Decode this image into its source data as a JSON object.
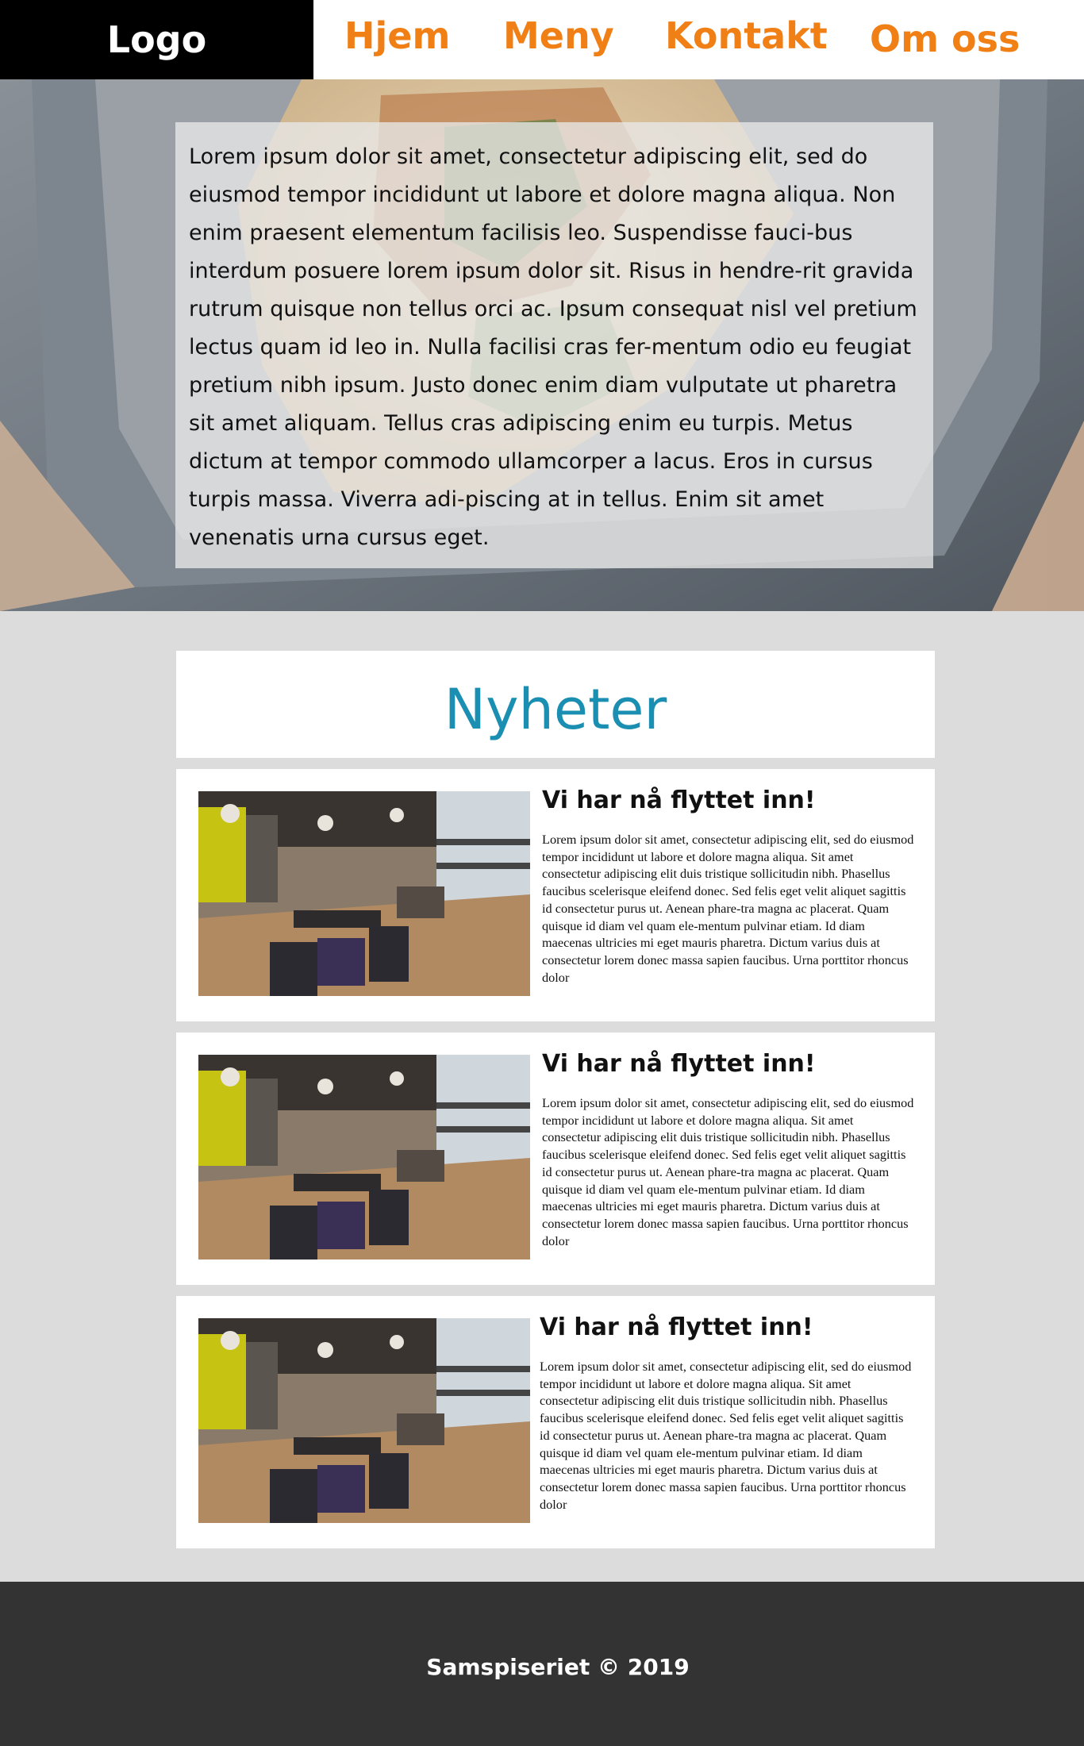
{
  "nav": {
    "logo": "Logo",
    "items": [
      {
        "label": "Hjem"
      },
      {
        "label": "Meny"
      },
      {
        "label": "Kontakt"
      },
      {
        "label": "Om oss"
      }
    ]
  },
  "hero": {
    "text": "Lorem ipsum dolor sit amet, consectetur adipiscing elit, sed do eiusmod tempor incididunt ut labore et dolore magna aliqua. Non enim praesent elementum facilisis leo. Suspendisse fauci-bus interdum posuere lorem ipsum dolor sit. Risus in hendre-rit gravida rutrum quisque non tellus orci ac. Ipsum consequat nisl vel pretium lectus quam id leo in. Nulla facilisi cras fer-mentum odio eu feugiat pretium nibh ipsum. Justo donec enim diam vulputate ut pharetra sit amet aliquam. Tellus cras adipiscing enim eu turpis. Metus dictum at tempor commodo ullamcorper a lacus. Eros in cursus turpis massa. Viverra adi-piscing at in tellus. Enim sit amet venenatis urna cursus eget."
  },
  "news": {
    "title": "Nyheter",
    "items": [
      {
        "title": "Vi har nå flyttet inn!",
        "body": "Lorem ipsum dolor sit amet, consectetur adipiscing elit, sed do eiusmod tempor incididunt ut labore et dolore magna aliqua. Sit amet consectetur adipiscing elit duis tristique sollicitudin nibh. Phasellus faucibus scelerisque eleifend donec. Sed felis eget velit aliquet sagittis id consectetur purus ut. Aenean phare-tra magna ac placerat. Quam quisque id diam vel quam ele-mentum pulvinar etiam. Id diam maecenas ultricies mi eget mauris pharetra. Dictum varius duis at consectetur lorem donec massa sapien faucibus. Urna porttitor rhoncus dolor"
      },
      {
        "title": "Vi har nå flyttet inn!",
        "body": "Lorem ipsum dolor sit amet, consectetur adipiscing elit, sed do eiusmod tempor incididunt ut labore et dolore magna aliqua. Sit amet consectetur adipiscing elit duis tristique sollicitudin nibh. Phasellus faucibus scelerisque eleifend donec. Sed felis eget velit aliquet sagittis id consectetur purus ut. Aenean phare-tra magna ac placerat. Quam quisque id diam vel quam ele-mentum pulvinar etiam. Id diam maecenas ultricies mi eget mauris pharetra. Dictum varius duis at consectetur lorem donec massa sapien faucibus. Urna porttitor rhoncus dolor"
      },
      {
        "title": "Vi har nå flyttet inn!",
        "body": "Lorem ipsum dolor sit amet, consectetur adipiscing elit, sed do eiusmod tempor incididunt ut labore et dolore magna aliqua. Sit amet consectetur adipiscing elit duis tristique sollicitudin nibh. Phasellus faucibus scelerisque eleifend donec. Sed felis eget velit aliquet sagittis id consectetur purus ut. Aenean phare-tra magna ac placerat. Quam quisque id diam vel quam ele-mentum pulvinar etiam. Id diam maecenas ultricies mi eget mauris pharetra. Dictum varius duis at consectetur lorem donec massa sapien faucibus. Urna porttitor rhoncus dolor"
      }
    ]
  },
  "footer": {
    "text": "Samspiseriet © 2019"
  },
  "colors": {
    "accent": "#f07f15",
    "news_title": "#1a8fb1",
    "footer_bg": "#333333",
    "page_bg": "#dcdcdc"
  }
}
